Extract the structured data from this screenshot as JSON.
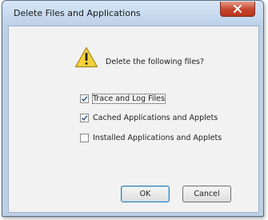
{
  "dialog": {
    "title": "Delete Files and Applications",
    "question": "Delete the following files?",
    "options": [
      {
        "label": "Trace and Log Files",
        "checked": true
      },
      {
        "label": "Cached Applications and Applets",
        "checked": true
      },
      {
        "label": "Installed Applications and Applets",
        "checked": false
      }
    ],
    "ok_label": "OK",
    "cancel_label": "Cancel"
  },
  "icons": {
    "title_close": "close-icon",
    "warning": "warning-icon",
    "check": "checkmark-icon"
  },
  "colors": {
    "titlebar": "#bcd1e9",
    "close_button": "#c8452d",
    "client_background": "#f2f2f2",
    "warning_yellow": "#f5d23c"
  }
}
